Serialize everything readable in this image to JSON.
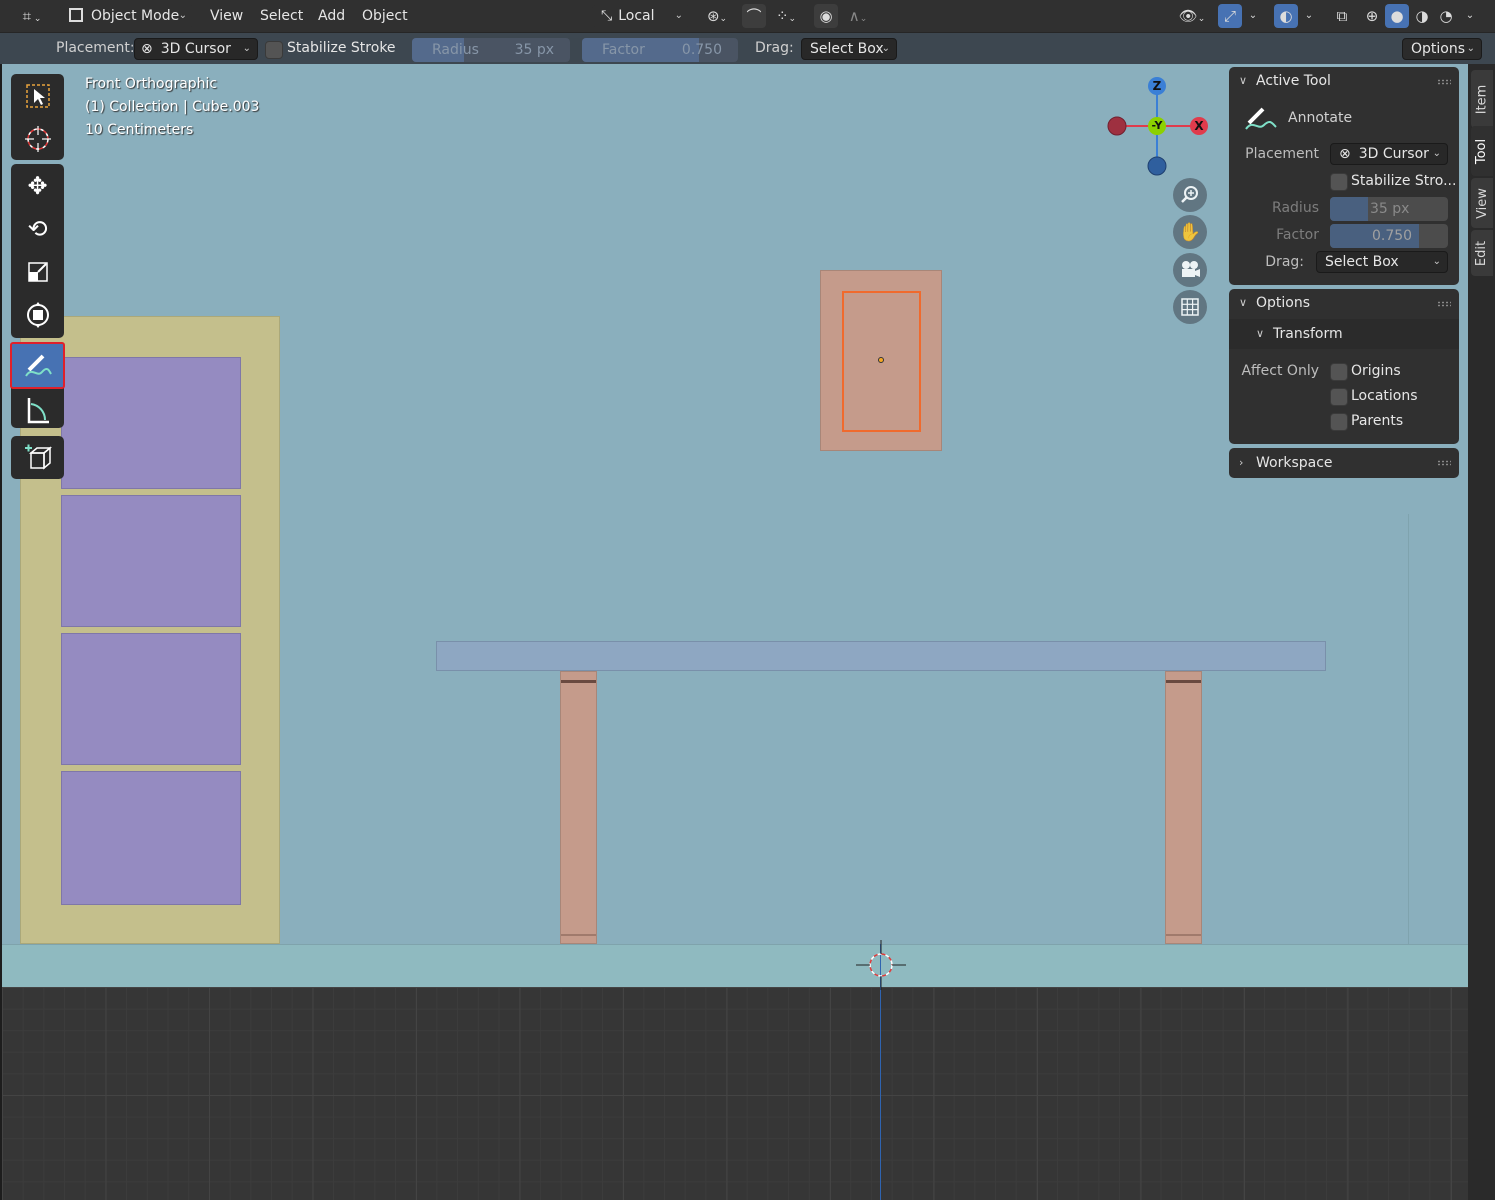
{
  "header": {
    "mode_label": "Object Mode",
    "menus": [
      "View",
      "Select",
      "Add",
      "Object"
    ],
    "transform_orientation": "Local"
  },
  "tool_header": {
    "placement_label": "Placement:",
    "placement_value": "3D Cursor",
    "stabilize_label": "Stabilize Stroke",
    "radius_label": "Radius",
    "radius_value": "35 px",
    "factor_label": "Factor",
    "factor_value": "0.750",
    "factor_fraction": 0.75,
    "drag_label": "Drag:",
    "drag_value": "Select Box",
    "options_label": "Options"
  },
  "viewport": {
    "view_name": "Front Orthographic",
    "collection_info": "(1) Collection | Cube.003",
    "scale_info": "10 Centimeters",
    "gizmo": {
      "z": "Z",
      "y": "-Y",
      "x": "X"
    }
  },
  "toolbar": {
    "tools": [
      "select-box",
      "cursor",
      "move",
      "rotate",
      "scale",
      "transform",
      "annotate",
      "measure",
      "add-cube"
    ],
    "active_tool": "annotate"
  },
  "sidebar": {
    "active_tool_title": "Active Tool",
    "tool_name": "Annotate",
    "placement_label": "Placement",
    "placement_value": "3D Cursor",
    "stabilize_label": "Stabilize Stro...",
    "radius_label": "Radius",
    "radius_value": "35 px",
    "factor_label": "Factor",
    "factor_value": "0.750",
    "drag_label": "Drag:",
    "drag_value": "Select Box",
    "options_title": "Options",
    "transform_title": "Transform",
    "affect_only_label": "Affect Only",
    "origins_label": "Origins",
    "locations_label": "Locations",
    "parents_label": "Parents",
    "workspace_title": "Workspace",
    "tabs": [
      "Item",
      "Tool",
      "View",
      "Edit"
    ]
  },
  "colors": {
    "accent": "#4772b3",
    "viewport_bg": "#8aafbd",
    "highlight_border": "#e0202a",
    "axis_x": "#e03b4c",
    "axis_y": "#8cd100",
    "axis_z": "#3a7fd6"
  }
}
